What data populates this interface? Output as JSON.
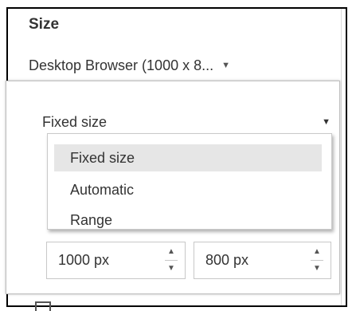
{
  "size_panel": {
    "title": "Size",
    "preset": "Desktop Browser (1000 x 8...",
    "size_mode": "Fixed size",
    "options": [
      {
        "label": "Fixed size",
        "selected": true
      },
      {
        "label": "Automatic",
        "selected": false
      },
      {
        "label": "Range",
        "selected": false
      }
    ],
    "width_value": "1000 px",
    "height_value": "800 px"
  },
  "icons": {
    "caret": "caret-down-icon",
    "spin_up": "spin-up-icon",
    "spin_down": "spin-down-icon"
  },
  "colors": {
    "selected_row": "#e6e6e6",
    "frame_border": "#000000",
    "text": "#333333"
  }
}
